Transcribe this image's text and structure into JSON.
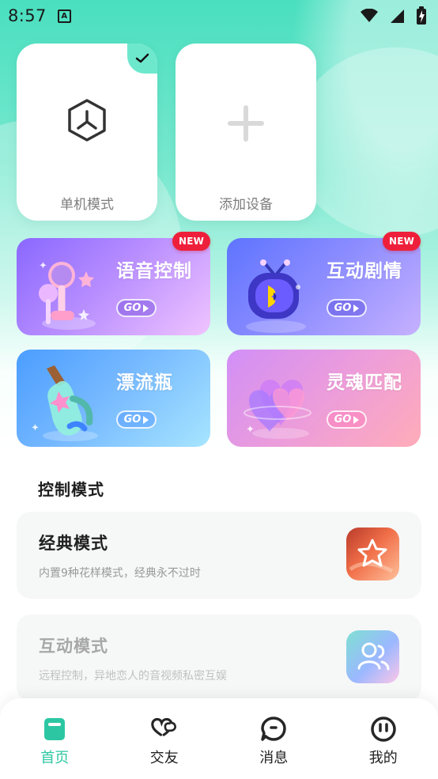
{
  "status_bar": {
    "time": "8:57",
    "notification_icon": "a-notification-icon",
    "right_icons": [
      "wifi-icon",
      "signal-icon",
      "battery-charging-icon"
    ]
  },
  "devices": [
    {
      "label": "单机模式",
      "icon": "hexagon-mode-icon",
      "selected": true,
      "check_icon": "check-icon"
    },
    {
      "label": "添加设备",
      "icon": "plus-icon",
      "selected": false
    }
  ],
  "features": [
    {
      "title": "语音控制",
      "go": "GO",
      "badge": "NEW",
      "icon": "microphone-illustration-icon",
      "colors": [
        "#9a6cff",
        "#dba4ff"
      ]
    },
    {
      "title": "互动剧情",
      "go": "GO",
      "badge": "NEW",
      "icon": "tv-play-illustration-icon",
      "colors": [
        "#6c7dff",
        "#b39cff"
      ]
    },
    {
      "title": "漂流瓶",
      "go": "GO",
      "badge": "",
      "icon": "drift-bottle-illustration-icon",
      "colors": [
        "#58a8ff",
        "#97d7ff"
      ]
    },
    {
      "title": "灵魂匹配",
      "go": "GO",
      "badge": "",
      "icon": "heart-illustration-icon",
      "colors": [
        "#d594f4",
        "#ff9fb4"
      ]
    }
  ],
  "section": {
    "title": "控制模式"
  },
  "modes": [
    {
      "title": "经典模式",
      "desc": "内置9种花样模式，经典永不过时",
      "icon": "star-thumbnail-icon",
      "enabled": true
    },
    {
      "title": "互动模式",
      "desc": "远程控制，异地恋人的音视频私密互娱",
      "icon": "users-thumbnail-icon",
      "enabled": false
    }
  ],
  "bottom_nav": [
    {
      "label": "首页",
      "icon": "home-icon",
      "active": true
    },
    {
      "label": "交友",
      "icon": "friends-icon",
      "active": false
    },
    {
      "label": "消息",
      "icon": "message-icon",
      "active": false
    },
    {
      "label": "我的",
      "icon": "profile-icon",
      "active": false
    }
  ],
  "colors": {
    "accent": "#2cc7a2",
    "header_green": "#49dfbf",
    "badge_red": "#ee1f3a"
  }
}
